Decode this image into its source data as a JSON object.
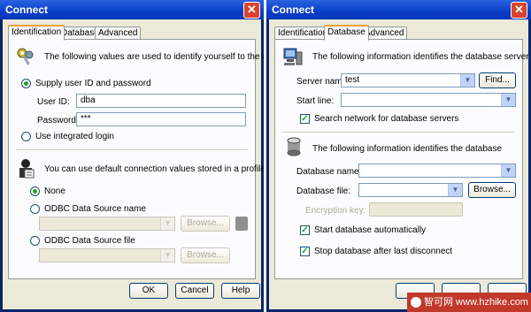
{
  "left": {
    "title": "Connect",
    "close": "✕",
    "tabs": [
      "Identification",
      "Database",
      "Advanced"
    ],
    "intro": "The following values are used to identify yourself to the database",
    "supply_label": "Supply user ID and password",
    "userid_label": "User ID:",
    "userid_value": "dba",
    "password_label": "Password:",
    "password_value": "***",
    "integrated_label": "Use integrated login",
    "profile_text": "You can use default connection values stored in a profile",
    "none_label": "None",
    "odbc_name_label": "ODBC Data Source name",
    "odbc_file_label": "ODBC Data Source file",
    "browse": "Browse...",
    "ok": "OK",
    "cancel": "Cancel",
    "help": "Help"
  },
  "right": {
    "title": "Connect",
    "close": "✕",
    "tabs": [
      "Identification",
      "Database",
      "Advanced"
    ],
    "server_intro": "The following information identifies the database server",
    "server_name_label": "Server name:",
    "server_name_value": "test",
    "find": "Find...",
    "start_line_label": "Start line:",
    "search_network_label": "Search network for database servers",
    "db_intro": "The following information identifies the database",
    "db_name_label": "Database name:",
    "db_file_label": "Database file:",
    "browse": "Browse...",
    "encryption_label": "Encryption key:",
    "start_auto_label": "Start database automatically",
    "stop_label": "Stop database after last disconnect"
  },
  "watermark": "智可网 www.hzhike.com",
  "colors": {
    "titlebar": "#0a3ec8",
    "dialog_bg": "#ece9d8",
    "tab_highlight": "#e8a33c",
    "watermark_bg": "#c0392b"
  },
  "icons": [
    "keys-icon",
    "profile-icon",
    "server-icon",
    "database-icon",
    "close-icon",
    "dropdown-icon",
    "gray-button-icon"
  ]
}
